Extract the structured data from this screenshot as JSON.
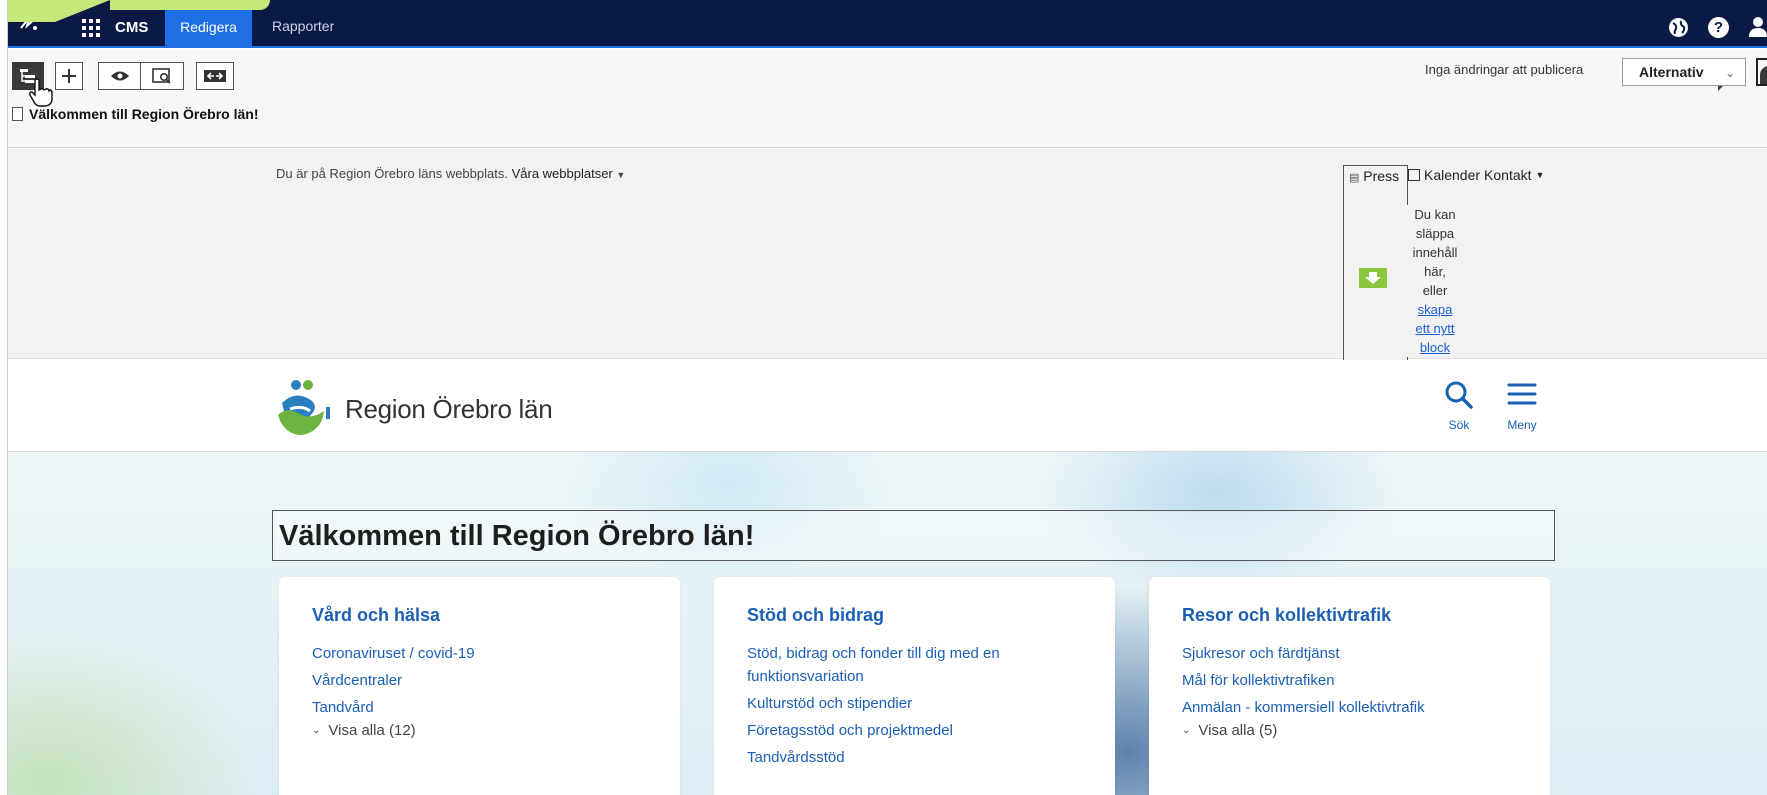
{
  "cms_bar": {
    "product": "CMS",
    "tabs": [
      {
        "label": "Redigera",
        "active": true
      },
      {
        "label": "Rapporter",
        "active": false
      }
    ],
    "help_glyph": "?"
  },
  "toolbar": {
    "page_title": "Välkommen till Region Örebro län!",
    "publish_status": "Inga ändringar att publicera",
    "options_label": "Alternativ"
  },
  "utility_bar": {
    "site_note": "Du är på Region Örebro läns webbplats.",
    "sites_link": "Våra webbplatser",
    "press": "Press",
    "calendar": "Kalender",
    "contact": "Kontakt",
    "dropzone_text_lines": [
      "Du kan",
      "släppa",
      "innehåll",
      "här,",
      "eller"
    ],
    "dropzone_link_lines": [
      "skapa",
      "ett nytt",
      "block"
    ]
  },
  "header": {
    "brand": "Region Örebro län",
    "search_label": "Sök",
    "menu_label": "Meny"
  },
  "hero": {
    "heading": "Välkommen till Region Örebro län!"
  },
  "cards": [
    {
      "title": "Vård och hälsa",
      "links": [
        "Coronaviruset / covid-19",
        "Vårdcentraler",
        "Tandvård"
      ],
      "more": "Visa alla (12)"
    },
    {
      "title": "Stöd och bidrag",
      "links": [
        "Stöd, bidrag och fonder till dig med en funktionsvariation",
        "Kulturstöd och stipendier",
        "Företagsstöd och projektmedel",
        "Tandvårdsstöd"
      ],
      "more": ""
    },
    {
      "title": "Resor och kollektivtrafik",
      "links": [
        "Sjukresor och färdtjänst",
        "Mål för kollektivtrafiken",
        "Anmälan - kommersiell kollektivtrafik"
      ],
      "more": "Visa alla (5)"
    }
  ],
  "colors": {
    "cms_bar": "#0a1a45",
    "cms_accent": "#1d6fe3",
    "site_link": "#1a5fb4",
    "drop_icon": "#8cc63f",
    "highlight": "#c5e87a"
  }
}
